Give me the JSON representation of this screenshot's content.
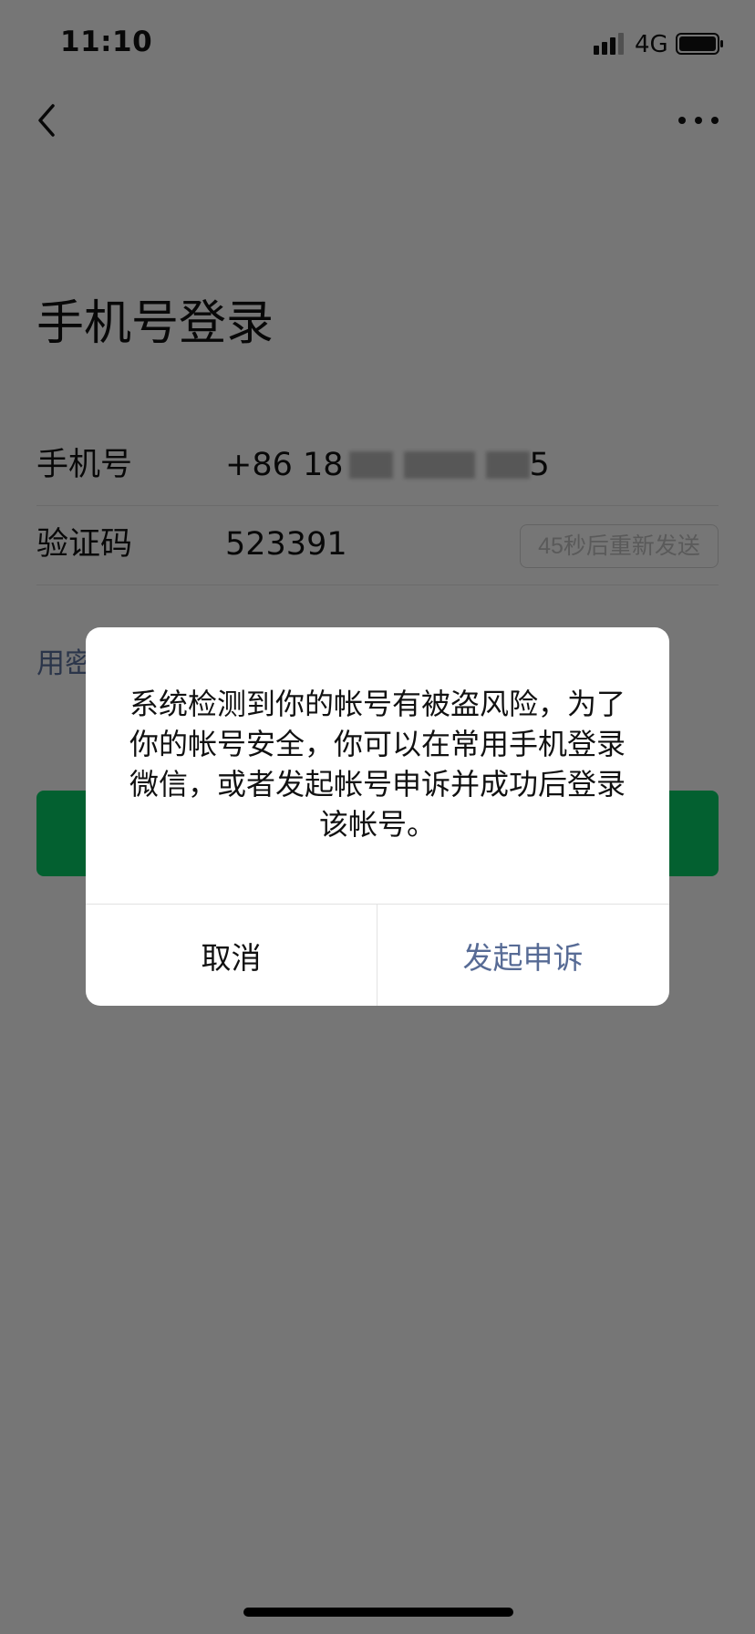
{
  "status_bar": {
    "time": "11:10",
    "network": "4G",
    "signal_icon": "signal-bars-icon",
    "battery_icon": "battery-icon"
  },
  "nav": {
    "back_icon": "chevron-left-icon",
    "more_icon": "ellipsis-icon"
  },
  "page": {
    "title": "手机号登录"
  },
  "form": {
    "phone_label": "手机号",
    "phone_prefix": "+86 18",
    "phone_suffix": "5",
    "code_label": "验证码",
    "code_value": "523391",
    "resend_label": "45秒后重新发送",
    "password_login_link": "用密",
    "primary_button_label": ""
  },
  "dialog": {
    "message": "系统检测到你的帐号有被盗风险，为了你的帐号安全，你可以在常用手机登录微信，或者发起帐号申诉并成功后登录该帐号。",
    "cancel_label": "取消",
    "appeal_label": "发起申诉"
  },
  "colors": {
    "primary_green": "#07c160",
    "link_blue": "#576b95",
    "overlay": "rgba(0,0,0,0.5)"
  }
}
